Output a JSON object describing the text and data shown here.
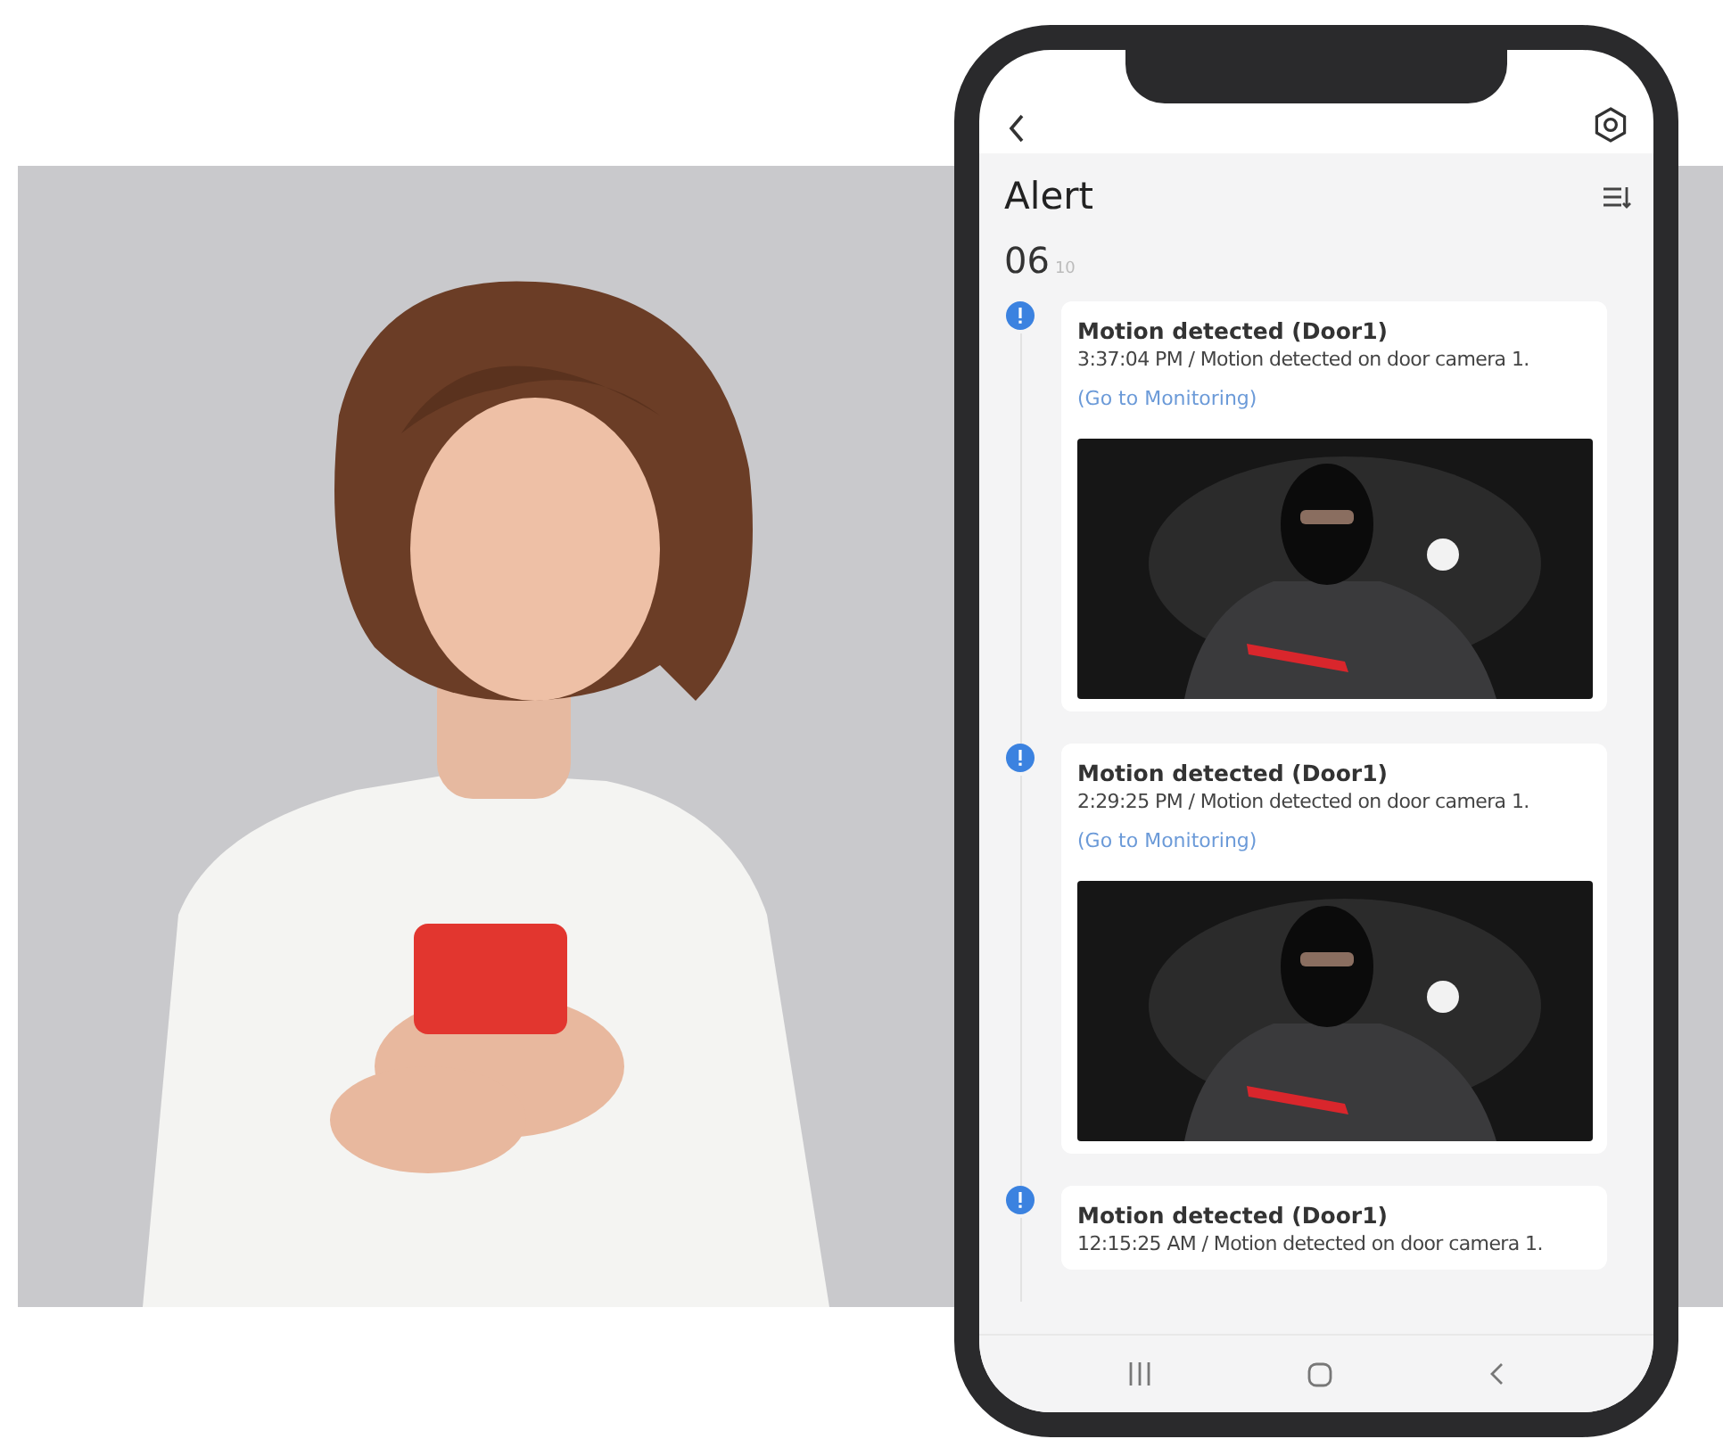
{
  "phone": {
    "title": "Alert",
    "date": {
      "day": "06",
      "month": "10"
    },
    "alerts": [
      {
        "title": "Motion detected (Door1)",
        "detail": "3:37:04 PM / Motion detected on door camera 1.",
        "link": "(Go to Monitoring)"
      },
      {
        "title": "Motion detected (Door1)",
        "detail": "2:29:25 PM / Motion detected on door camera 1.",
        "link": "(Go to Monitoring)"
      },
      {
        "title": "Motion detected (Door1)",
        "detail": "12:15:25 AM / Motion detected on door camera 1."
      }
    ]
  }
}
